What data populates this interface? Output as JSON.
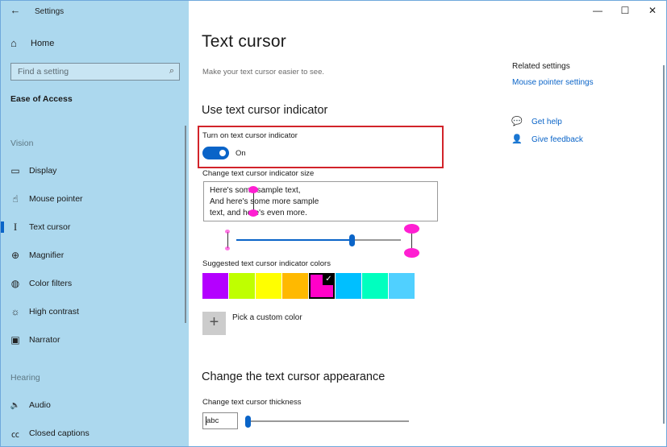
{
  "window": {
    "title": "Settings",
    "controls": {
      "minimize": "—",
      "maximize": "☐",
      "close": "✕"
    }
  },
  "sidebar": {
    "back_icon": "←",
    "home": {
      "icon": "⌂",
      "label": "Home"
    },
    "search": {
      "placeholder": "Find a setting",
      "icon": "⌕"
    },
    "category": "Ease of Access",
    "groups": [
      {
        "header": "Vision",
        "items": [
          {
            "icon": "▭",
            "label": "Display"
          },
          {
            "icon": "☝",
            "label": "Mouse pointer"
          },
          {
            "icon": "I",
            "label": "Text cursor",
            "active": true
          },
          {
            "icon": "⊕",
            "label": "Magnifier"
          },
          {
            "icon": "◍",
            "label": "Color filters"
          },
          {
            "icon": "☼",
            "label": "High contrast"
          },
          {
            "icon": "▣",
            "label": "Narrator"
          }
        ]
      },
      {
        "header": "Hearing",
        "items": [
          {
            "icon": "🔈",
            "label": "Audio"
          },
          {
            "icon": "㏄",
            "label": "Closed captions"
          }
        ]
      }
    ]
  },
  "main": {
    "title": "Text cursor",
    "description": "Make your text cursor easier to see.",
    "indicator_section": {
      "title": "Use text cursor indicator",
      "toggle_label": "Turn on text cursor indicator",
      "toggle_state": "On",
      "toggle_on": true,
      "size_label": "Change text cursor indicator size",
      "sample_lines": [
        "Here's some sample text,",
        "And here's some more sample",
        "text, and here's even more."
      ],
      "size_slider_value_pct": 70,
      "colors_label": "Suggested text cursor indicator colors",
      "colors": [
        "#b400ff",
        "#bfff00",
        "#ffff00",
        "#ffb900",
        "#ff00c8",
        "#00bfff",
        "#00ffbf",
        "#50d0ff"
      ],
      "selected_color_index": 4,
      "check_icon": "✓",
      "custom_color_icon": "+",
      "custom_color_label": "Pick a custom color"
    },
    "appearance_section": {
      "title": "Change the text cursor appearance",
      "thickness_label": "Change text cursor thickness",
      "thickness_preview": "abc",
      "thickness_slider_value_pct": 0
    }
  },
  "related": {
    "header": "Related settings",
    "links": [
      "Mouse pointer settings"
    ],
    "help": {
      "icon": "💬",
      "label": "Get help"
    },
    "feedback": {
      "icon": "👤",
      "label": "Give feedback"
    }
  },
  "colors": {
    "accent": "#0a64c8",
    "sidebar_bg": "#acd8ee",
    "highlight_border": "#d2232a",
    "indicator": "#ff1fd2"
  }
}
